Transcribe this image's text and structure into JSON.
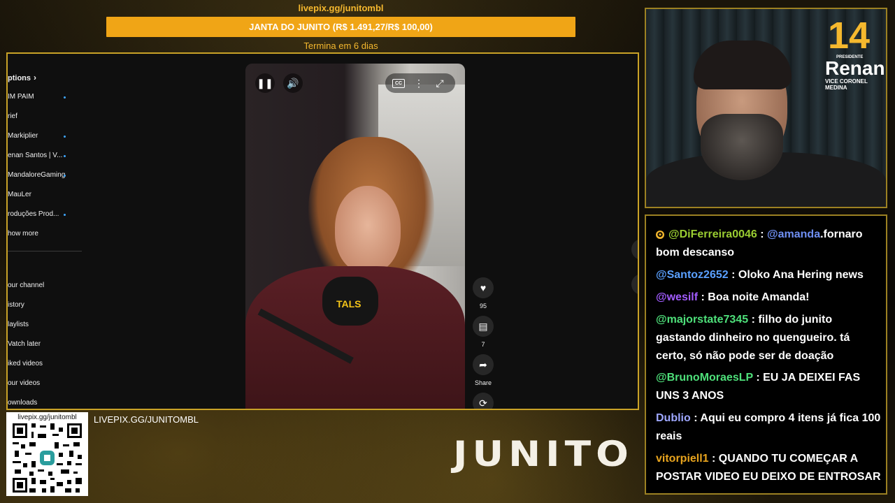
{
  "goal": {
    "url": "livepix.gg/junitombl",
    "bar_text": "JANTA DO JUNITO (R$ 1.491,27/R$ 100,00)",
    "ends": "Termina em 6 dias",
    "bar_color": "#f0a516"
  },
  "sidebar": {
    "header": "ptions",
    "subscriptions": [
      {
        "label": "IM PAIM",
        "dot": true
      },
      {
        "label": "rief",
        "dot": false
      },
      {
        "label": "Markiplier",
        "dot": true
      },
      {
        "label": "enan Santos | V...",
        "dot": true
      },
      {
        "label": "MandaloreGaming",
        "dot": true
      },
      {
        "label": "MauLer",
        "dot": false
      },
      {
        "label": "roduções Prod...",
        "dot": true
      },
      {
        "label": "how more",
        "dot": false
      }
    ],
    "you": [
      {
        "label": "our channel"
      },
      {
        "label": "istory"
      },
      {
        "label": "laylists"
      },
      {
        "label": "Vatch later"
      },
      {
        "label": "iked videos"
      },
      {
        "label": "our videos"
      },
      {
        "label": "ownloads"
      }
    ]
  },
  "video": {
    "mic_label": "TALS",
    "controls": [
      "pause-icon",
      "volume-icon",
      "captions-icon",
      "more-icon",
      "fullscreen-icon"
    ],
    "captions_label": "CC"
  },
  "actions": {
    "like_count": "95",
    "comment_count": "7",
    "share_label": "Share"
  },
  "qr": {
    "url": "livepix.gg/junitombl"
  },
  "bottom_url": "LIVEPIX.GG/JUNITOMBL",
  "brand": "JUNITO",
  "campaign": {
    "number": "14",
    "prefix": "PRESIDENTE",
    "name": "Renan",
    "vice": "VICE CORONEL MEDINA",
    "color": "#f5b82e"
  },
  "chat": [
    {
      "badge": true,
      "user": "@DiFerreira0046",
      "color": "#9acd32",
      "mention": "@amanda",
      "mention_color": "#6f8ff2",
      "text": ".fornaro bom descanso"
    },
    {
      "badge": false,
      "user": "@Santoz2652",
      "color": "#5aa0ff",
      "mention": "",
      "mention_color": "",
      "text": ": Oloko Ana Hering news"
    },
    {
      "badge": false,
      "user": "@wesilf",
      "color": "#a25cff",
      "mention": "",
      "mention_color": "",
      "text": ": Boa noite Amanda!"
    },
    {
      "badge": false,
      "user": "@majorstate7345",
      "color": "#4ee07a",
      "mention": "",
      "mention_color": "",
      "text": ": filho do junito gastando dinheiro no quengueiro. tá certo, só não pode ser de doação"
    },
    {
      "badge": false,
      "user": "@BrunoMoraesLP",
      "color": "#4ee07a",
      "mention": "",
      "mention_color": "",
      "text": ": EU JA DEIXEI FAS UNS 3 ANOS"
    },
    {
      "badge": false,
      "user": "Dublio",
      "color": "#9ea7ff",
      "mention": "",
      "mention_color": "",
      "text": ": Aqui eu compro 4 itens já fica 100 reais"
    },
    {
      "badge": false,
      "user": "vitorpiell1",
      "color": "#e8a41e",
      "mention": "",
      "mention_color": "",
      "text": ": QUANDO TU COMEÇAR A POSTAR VIDEO EU DEIXO DE ENTROSAR"
    }
  ]
}
